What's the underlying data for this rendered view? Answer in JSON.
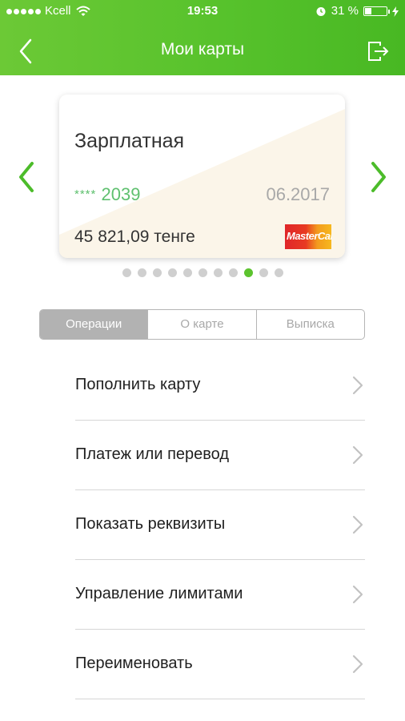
{
  "status_bar": {
    "carrier": "Kcell",
    "time": "19:53",
    "battery_text": "31 %",
    "battery_level": 0.31
  },
  "nav": {
    "title": "Мои карты",
    "back_icon": "chevron-left-icon",
    "logout_icon": "logout-icon"
  },
  "card": {
    "name": "Зарплатная",
    "number_mask": "****",
    "number_last": "2039",
    "expiry": "06.2017",
    "balance": "45 821,09 тенге",
    "logo_text": "MasterCard"
  },
  "carousel": {
    "total": 11,
    "active_index": 8
  },
  "tabs": [
    {
      "label": "Операции",
      "active": true
    },
    {
      "label": "О карте",
      "active": false
    },
    {
      "label": "Выписка",
      "active": false
    }
  ],
  "menu": [
    {
      "label": "Пополнить карту"
    },
    {
      "label": "Платеж или перевод"
    },
    {
      "label": "Показать реквизиты"
    },
    {
      "label": "Управление лимитами"
    },
    {
      "label": "Переименовать"
    }
  ],
  "colors": {
    "brand_green": "#5cc32e",
    "card_number": "#5fc06f",
    "inactive_dot": "#cfcfcf",
    "active_tab": "#b2b2b2"
  }
}
